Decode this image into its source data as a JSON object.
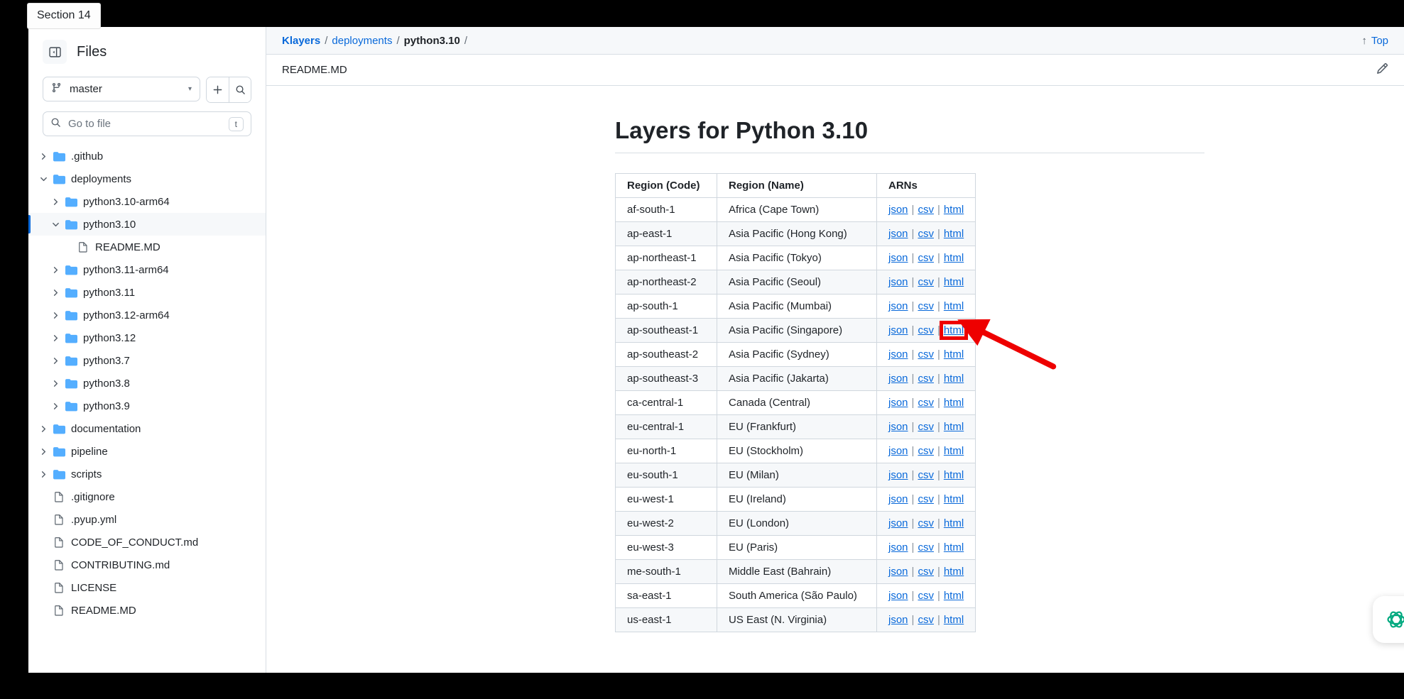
{
  "section_badge": "Section 14",
  "sidebar": {
    "title": "Files",
    "panel_toggle_icon": "sidebar-collapse-icon",
    "branch": {
      "name": "master",
      "icon": "branch-icon",
      "caret": "▾"
    },
    "add_button_label": "+",
    "search_button_icon": "search-icon",
    "go_to_file": {
      "placeholder": "Go to file",
      "shortcut": "t",
      "icon": "search-icon"
    },
    "tree": [
      {
        "label": ".github",
        "type": "folder",
        "depth": 0,
        "state": "collapsed",
        "selected": false
      },
      {
        "label": "deployments",
        "type": "folder",
        "depth": 0,
        "state": "expanded",
        "selected": false
      },
      {
        "label": "python3.10-arm64",
        "type": "folder",
        "depth": 1,
        "state": "collapsed",
        "selected": false
      },
      {
        "label": "python3.10",
        "type": "folder",
        "depth": 1,
        "state": "expanded",
        "selected": true
      },
      {
        "label": "README.MD",
        "type": "file",
        "depth": 2,
        "state": "none",
        "selected": false
      },
      {
        "label": "python3.11-arm64",
        "type": "folder",
        "depth": 1,
        "state": "collapsed",
        "selected": false
      },
      {
        "label": "python3.11",
        "type": "folder",
        "depth": 1,
        "state": "collapsed",
        "selected": false
      },
      {
        "label": "python3.12-arm64",
        "type": "folder",
        "depth": 1,
        "state": "collapsed",
        "selected": false
      },
      {
        "label": "python3.12",
        "type": "folder",
        "depth": 1,
        "state": "collapsed",
        "selected": false
      },
      {
        "label": "python3.7",
        "type": "folder",
        "depth": 1,
        "state": "collapsed",
        "selected": false
      },
      {
        "label": "python3.8",
        "type": "folder",
        "depth": 1,
        "state": "collapsed",
        "selected": false
      },
      {
        "label": "python3.9",
        "type": "folder",
        "depth": 1,
        "state": "collapsed",
        "selected": false
      },
      {
        "label": "documentation",
        "type": "folder",
        "depth": 0,
        "state": "collapsed",
        "selected": false
      },
      {
        "label": "pipeline",
        "type": "folder",
        "depth": 0,
        "state": "collapsed",
        "selected": false
      },
      {
        "label": "scripts",
        "type": "folder",
        "depth": 0,
        "state": "collapsed",
        "selected": false
      },
      {
        "label": ".gitignore",
        "type": "file",
        "depth": 0,
        "state": "none",
        "selected": false
      },
      {
        "label": ".pyup.yml",
        "type": "file",
        "depth": 0,
        "state": "none",
        "selected": false
      },
      {
        "label": "CODE_OF_CONDUCT.md",
        "type": "file",
        "depth": 0,
        "state": "none",
        "selected": false
      },
      {
        "label": "CONTRIBUTING.md",
        "type": "file",
        "depth": 0,
        "state": "none",
        "selected": false
      },
      {
        "label": "LICENSE",
        "type": "file",
        "depth": 0,
        "state": "none",
        "selected": false
      },
      {
        "label": "README.MD",
        "type": "file",
        "depth": 0,
        "state": "none",
        "selected": false
      }
    ]
  },
  "main": {
    "breadcrumb": {
      "repo": "Klayers",
      "items": [
        "deployments",
        "python3.10"
      ],
      "separator": "/",
      "trailing_separator": "/"
    },
    "top_link": {
      "label": "Top",
      "arrow": "↑"
    },
    "file_name": "README.MD",
    "edit_icon": "pencil-icon",
    "doc_title": "Layers for Python 3.10",
    "table": {
      "headers": [
        "Region (Code)",
        "Region (Name)",
        "ARNs"
      ],
      "link_labels": [
        "json",
        "csv",
        "html"
      ],
      "separator": "|",
      "rows": [
        {
          "code": "af-south-1",
          "name": "Africa (Cape Town)"
        },
        {
          "code": "ap-east-1",
          "name": "Asia Pacific (Hong Kong)"
        },
        {
          "code": "ap-northeast-1",
          "name": "Asia Pacific (Tokyo)"
        },
        {
          "code": "ap-northeast-2",
          "name": "Asia Pacific (Seoul)"
        },
        {
          "code": "ap-south-1",
          "name": "Asia Pacific (Mumbai)"
        },
        {
          "code": "ap-southeast-1",
          "name": "Asia Pacific (Singapore)",
          "highlight_html": true
        },
        {
          "code": "ap-southeast-2",
          "name": "Asia Pacific (Sydney)"
        },
        {
          "code": "ap-southeast-3",
          "name": "Asia Pacific (Jakarta)"
        },
        {
          "code": "ca-central-1",
          "name": "Canada (Central)"
        },
        {
          "code": "eu-central-1",
          "name": "EU (Frankfurt)"
        },
        {
          "code": "eu-north-1",
          "name": "EU (Stockholm)"
        },
        {
          "code": "eu-south-1",
          "name": "EU (Milan)"
        },
        {
          "code": "eu-west-1",
          "name": "EU (Ireland)"
        },
        {
          "code": "eu-west-2",
          "name": "EU (London)"
        },
        {
          "code": "eu-west-3",
          "name": "EU (Paris)"
        },
        {
          "code": "me-south-1",
          "name": "Middle East (Bahrain)"
        },
        {
          "code": "sa-east-1",
          "name": "South America (São Paulo)"
        },
        {
          "code": "us-east-1",
          "name": "US East (N. Virginia)"
        }
      ]
    },
    "float_widget_icon": "atom-logo-icon"
  },
  "annotation": {
    "box_color": "#ee0000",
    "arrow_color": "#ee0000",
    "target": "html-link-ap-southeast-1"
  },
  "colors": {
    "link": "#0969da",
    "folder": "#54aeff",
    "text": "#1f2328",
    "muted": "#636c76",
    "surface": "#f6f8fa",
    "border": "#d0d7de",
    "accent_green": "#00a97f"
  }
}
